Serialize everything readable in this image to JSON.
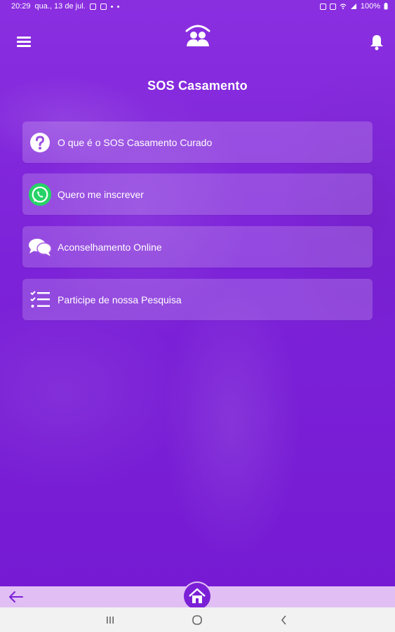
{
  "status": {
    "time": "20:29",
    "date": "qua., 13 de jul.",
    "battery": "100%"
  },
  "header": {
    "title": "SOS Casamento"
  },
  "menu": [
    {
      "label": "O que é o SOS Casamento Curado",
      "icon": "question-circle-icon"
    },
    {
      "label": "Quero me inscrever",
      "icon": "whatsapp-icon"
    },
    {
      "label": "Aconselhamento Online",
      "icon": "chat-bubbles-icon"
    },
    {
      "label": "Participe de nossa Pesquisa",
      "icon": "checklist-icon"
    }
  ],
  "colors": {
    "primary": "#7a1fd6",
    "bottom_bar": "#e1bff5",
    "whatsapp": "#25d366"
  }
}
